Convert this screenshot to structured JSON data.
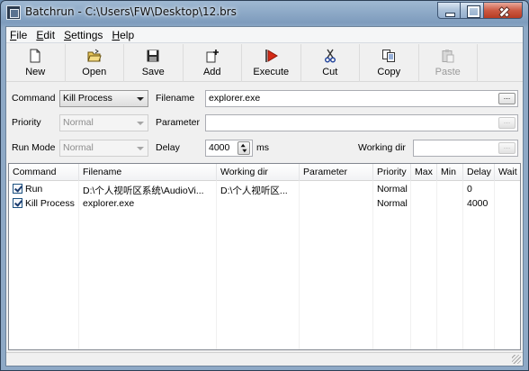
{
  "window": {
    "title": "Batchrun - C:\\Users\\FW\\Desktop\\12.brs"
  },
  "menu": [
    {
      "pre": "",
      "u": "F",
      "post": "ile"
    },
    {
      "pre": "",
      "u": "E",
      "post": "dit"
    },
    {
      "pre": "",
      "u": "S",
      "post": "ettings"
    },
    {
      "pre": "",
      "u": "H",
      "post": "elp"
    }
  ],
  "toolbar": {
    "new": "New",
    "open": "Open",
    "save": "Save",
    "add": "Add",
    "execute": "Execute",
    "cut": "Cut",
    "copy": "Copy",
    "paste": "Paste"
  },
  "colors": {
    "execute_icon": "#d42a16",
    "title_text": "#111111",
    "disabled_text": "#8d8d8d"
  },
  "form": {
    "command_label": "Command",
    "command_value": "Kill Process",
    "filename_label": "Filename",
    "filename_value": "explorer.exe",
    "priority_label": "Priority",
    "priority_value": "Normal",
    "parameter_label": "Parameter",
    "parameter_value": "",
    "runmode_label": "Run Mode",
    "runmode_value": "Normal",
    "delay_label": "Delay",
    "delay_value": "4000",
    "delay_unit": "ms",
    "workingdir_label": "Working dir",
    "workingdir_value": "",
    "browse_label": "..."
  },
  "list": {
    "columns": [
      "Command",
      "Filename",
      "Working dir",
      "Parameter",
      "Priority",
      "Max",
      "Min",
      "Delay",
      "Wait"
    ],
    "rows": [
      {
        "checked": true,
        "command": "Run",
        "filename": "D:\\个人视听区系统\\AudioVi...",
        "workingdir": "D:\\个人视听区...",
        "parameter": "",
        "priority": "Normal",
        "max": "",
        "min": "",
        "delay": "0",
        "wait": ""
      },
      {
        "checked": true,
        "command": "Kill Process",
        "filename": "explorer.exe",
        "workingdir": "",
        "parameter": "",
        "priority": "Normal",
        "max": "",
        "min": "",
        "delay": "4000",
        "wait": ""
      }
    ]
  }
}
